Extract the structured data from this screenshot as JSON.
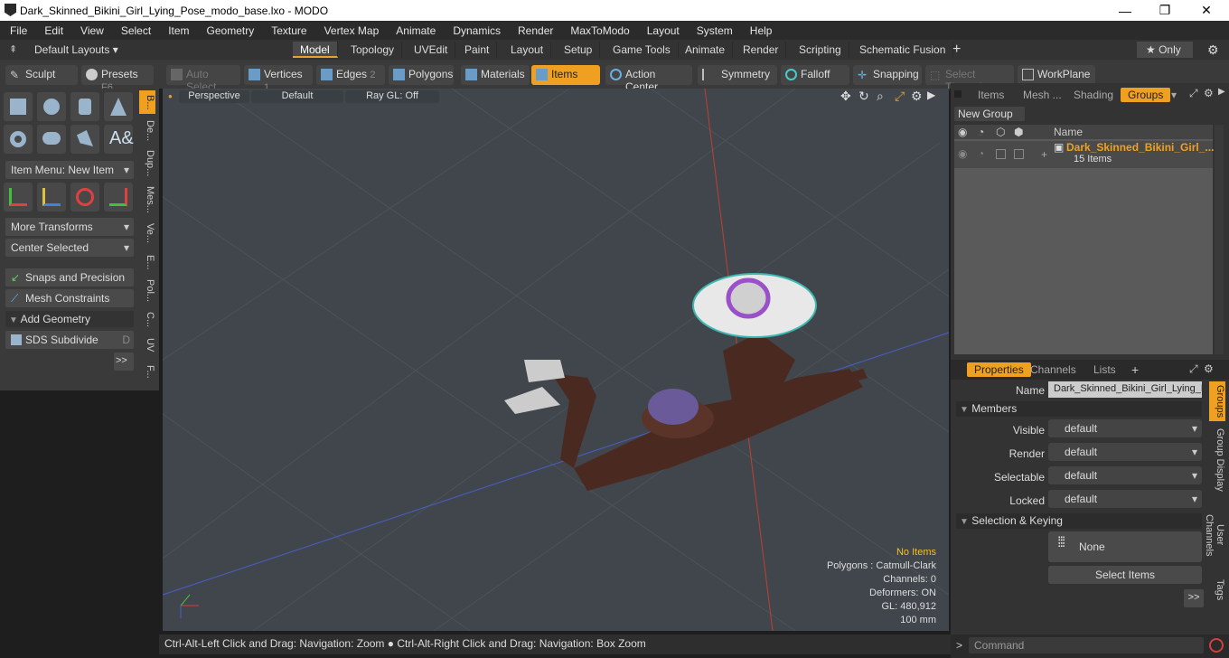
{
  "window": {
    "title": "Dark_Skinned_Bikini_Girl_Lying_Pose_modo_base.lxo - MODO",
    "min": "—",
    "max": "❐",
    "close": "✕"
  },
  "menu": [
    "File",
    "Edit",
    "View",
    "Select",
    "Item",
    "Geometry",
    "Texture",
    "Vertex Map",
    "Animate",
    "Dynamics",
    "Render",
    "MaxToModo",
    "Layout",
    "System",
    "Help"
  ],
  "layouts": {
    "label": "Default Layouts ▾",
    "tabs": [
      "Model",
      "Topology",
      "UVEdit",
      "Paint",
      "Layout",
      "Setup",
      "Game Tools",
      "Animate",
      "Render",
      "Scripting",
      "Schematic Fusion"
    ],
    "plus": "+",
    "only": "★ Only"
  },
  "toolbar": {
    "sculpt": "Sculpt",
    "presets": "Presets",
    "presets_key": "F6",
    "auto_select": "Auto Select",
    "vertices": "Vertices",
    "vertices_n": "1",
    "edges": "Edges",
    "edges_n": "2",
    "polygons": "Polygons",
    "materials": "Materials",
    "items": "Items",
    "action_center": "Action Center",
    "symmetry": "Symmetry",
    "falloff": "Falloff",
    "snapping": "Snapping",
    "select_through": "Select Through",
    "workplane": "WorkPlane"
  },
  "left": {
    "item_menu": "Item Menu: New Item",
    "more_transforms": "More Transforms",
    "center_selected": "Center Selected",
    "snaps": "Snaps and Precision",
    "mesh_constraints": "Mesh Constraints",
    "add_geometry": "Add Geometry",
    "sds": "SDS Subdivide",
    "sds_key": "D",
    "more": ">>",
    "vtabs": [
      "B...",
      "De...",
      "Dup...",
      "Mes...",
      "Ve...",
      "E...",
      "Pol...",
      "C...",
      "UV",
      "F..."
    ]
  },
  "viewport": {
    "perspective": "Perspective",
    "default": "Default",
    "raygl": "Ray GL: Off",
    "info": {
      "no_items": "No Items",
      "polygons": "Polygons : Catmull-Clark",
      "channels": "Channels: 0",
      "deformers": "Deformers: ON",
      "gl": "GL: 480,912",
      "scale": "100 mm"
    }
  },
  "status": "Ctrl-Alt-Left Click and Drag: Navigation: Zoom ● Ctrl-Alt-Right Click and Drag: Navigation: Box Zoom",
  "right": {
    "tabs": [
      "Items",
      "Mesh ...",
      "Shading",
      "Groups"
    ],
    "new_group": "New Group",
    "col_name": "Name",
    "group_name": "Dark_Skinned_Bikini_Girl_...",
    "group_count": "15 Items",
    "ptabs": [
      "Properties",
      "Channels",
      "Lists"
    ],
    "plus": "+",
    "name_label": "Name",
    "name_value": "Dark_Skinned_Bikini_Girl_Lying_Po",
    "members": "Members",
    "visible": "Visible",
    "render": "Render",
    "selectable": "Selectable",
    "locked": "Locked",
    "default": "default",
    "sel_keying": "Selection & Keying",
    "none": "None",
    "select_items": "Select Items",
    "more": ">>",
    "vtabs": [
      "Groups",
      "Group Display",
      "User Channels",
      "Tags"
    ],
    "command": "Command"
  }
}
